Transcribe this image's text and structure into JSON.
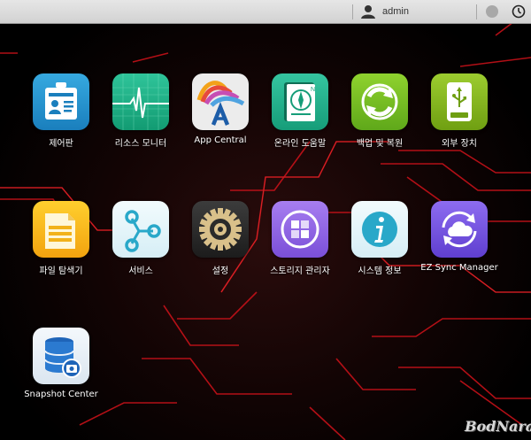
{
  "topbar": {
    "username": "admin",
    "user_icon": "user-icon",
    "notification_icon": "notification-icon",
    "power_icon": "power-icon"
  },
  "apps": [
    {
      "label": "제어판",
      "icon": "control-panel-id-card-icon"
    },
    {
      "label": "리소스 모니터",
      "icon": "resource-monitor-heartbeat-icon"
    },
    {
      "label": "App Central",
      "icon": "app-central-icon"
    },
    {
      "label": "온라인 도움말",
      "icon": "online-help-compass-book-icon"
    },
    {
      "label": "백업 및 복원",
      "icon": "backup-restore-arrows-icon"
    },
    {
      "label": "외부 장치",
      "icon": "external-device-usb-icon"
    },
    {
      "label": "파일 탐색기",
      "icon": "file-explorer-folder-icon"
    },
    {
      "label": "서비스",
      "icon": "services-network-nodes-icon"
    },
    {
      "label": "설정",
      "icon": "settings-gear-icon"
    },
    {
      "label": "스토리지 관리자",
      "icon": "storage-manager-blocks-icon"
    },
    {
      "label": "시스템 정보",
      "icon": "system-info-icon"
    },
    {
      "label": "EZ Sync Manager",
      "icon": "ez-sync-cloud-icon"
    },
    {
      "label": "Snapshot Center",
      "icon": "snapshot-database-camera-icon"
    }
  ],
  "colors": {
    "topbar": "#dcdcdc",
    "circuit_line": "#e0141a",
    "label_text": "#ffffff"
  },
  "watermark": "BodNara"
}
